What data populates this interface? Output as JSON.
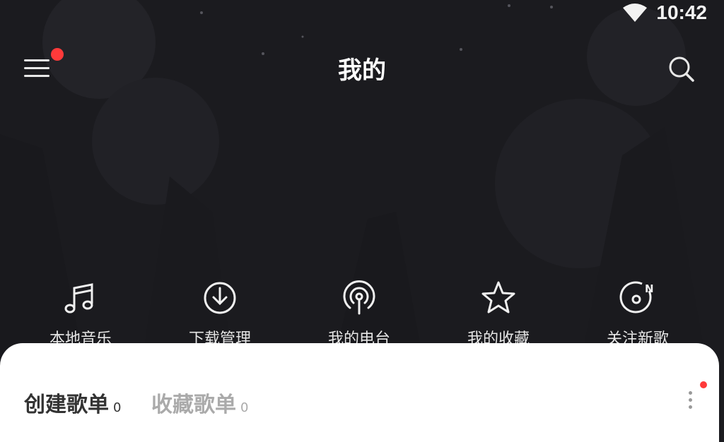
{
  "status_bar": {
    "time": "10:42",
    "wifi_icon": "wifi-icon"
  },
  "header": {
    "title": "我的",
    "menu_icon": "menu-icon",
    "search_icon": "search-icon"
  },
  "shortcuts": [
    {
      "label": "本地音乐",
      "icon": "music-note-icon"
    },
    {
      "label": "下载管理",
      "icon": "download-icon"
    },
    {
      "label": "我的电台",
      "icon": "radio-icon"
    },
    {
      "label": "我的收藏",
      "icon": "star-icon"
    },
    {
      "label": "关注新歌",
      "icon": "new-song-icon"
    }
  ],
  "playlists": {
    "tabs": [
      {
        "label": "创建歌单",
        "count": "0"
      },
      {
        "label": "收藏歌单",
        "count": "0"
      }
    ],
    "more_icon": "more-vertical-icon"
  },
  "colors": {
    "background": "#1b1b1f",
    "badge": "#ff3a3a",
    "sheet": "#ffffff"
  }
}
